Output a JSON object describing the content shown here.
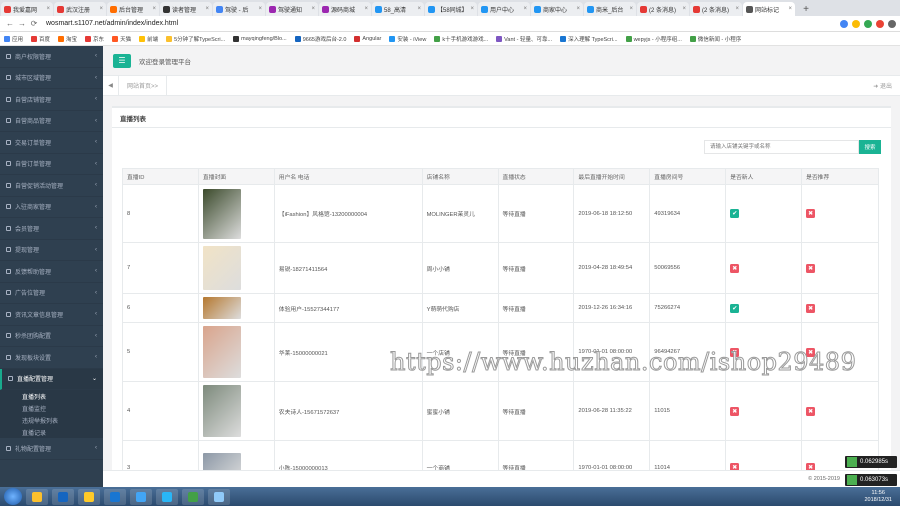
{
  "browser": {
    "tabs": [
      {
        "label": "我爱嘉网",
        "color": "#e53935"
      },
      {
        "label": "武汉注册",
        "color": "#e53935"
      },
      {
        "label": "后台管理",
        "color": "#ff6d00"
      },
      {
        "label": "读者管理",
        "color": "#333333"
      },
      {
        "label": "驾驶 - 后",
        "color": "#4285f4"
      },
      {
        "label": "驾驶通知",
        "color": "#9c27b0"
      },
      {
        "label": "源码商城",
        "color": "#9c27b0"
      },
      {
        "label": "58_高清",
        "color": "#2196f3"
      },
      {
        "label": "【58同城】",
        "color": "#2196f3"
      },
      {
        "label": "用户中心",
        "color": "#2196f3"
      },
      {
        "label": "商家中心",
        "color": "#2196f3"
      },
      {
        "label": "商米_后台",
        "color": "#2196f3"
      },
      {
        "label": "(2 条消息)",
        "color": "#e53935"
      },
      {
        "label": "(2 条消息)",
        "color": "#e53935"
      },
      {
        "label": "网站标记",
        "color": "#555555",
        "active": true
      }
    ],
    "url": "wosmart.s1107.net/admin/index/index.html",
    "bookmarks": [
      "应用",
      "百度",
      "淘宝",
      "京东",
      "天猫",
      "前端",
      "5分钟了解TypeScri...",
      "mayqingfeng/Blo...",
      "9665游戏后台-2.0",
      "Angular",
      "安装 - iView",
      "k十手机游戏游戏...",
      "Vant - 轻量、可靠...",
      "深入理解 TypeScri...",
      "wepyjs - 小程序组...",
      "微信新闻 - 小程序"
    ]
  },
  "sidebar": {
    "items": [
      {
        "label": "商户权限管理",
        "active": false
      },
      {
        "label": "城市区域管理",
        "active": false
      },
      {
        "label": "自营店铺管理",
        "active": false
      },
      {
        "label": "自营商品管理",
        "active": false
      },
      {
        "label": "交易订单管理",
        "active": false
      },
      {
        "label": "自营订单管理",
        "active": false
      },
      {
        "label": "自营促销活动管理",
        "active": false
      },
      {
        "label": "入驻商家管理",
        "active": false
      },
      {
        "label": "会员管理",
        "active": false
      },
      {
        "label": "提现管理",
        "active": false
      },
      {
        "label": "反馈帮助管理",
        "active": false
      },
      {
        "label": "广告位管理",
        "active": false
      },
      {
        "label": "资讯文章信息管理",
        "active": false
      },
      {
        "label": "秒杀团购配置",
        "active": false
      },
      {
        "label": "发现板块设置",
        "active": false
      },
      {
        "label": "直播配置管理",
        "active": true
      }
    ],
    "subitems": [
      {
        "label": "直播列表",
        "active": true
      },
      {
        "label": "直播监控",
        "active": false
      },
      {
        "label": "违规举报列表",
        "active": false
      },
      {
        "label": "直播记录",
        "active": false
      }
    ],
    "last_item": "礼物配置管理"
  },
  "header": {
    "menu_icon": "☰",
    "welcome": "欢迎登录管理平台"
  },
  "crumbs": {
    "back": "◀",
    "tab": "网站首页>>",
    "logout": "➜ 退出"
  },
  "panel": {
    "title": "直播列表",
    "search_placeholder": "请输入店铺关键字或名称",
    "search_button": "搜索"
  },
  "table": {
    "headers": [
      "直播ID",
      "直播封面",
      "用户名 电话",
      "店铺名称",
      "直播状态",
      "最后直播开始时间",
      "直播房间号",
      "是否新人",
      "是否推荐"
    ],
    "rows": [
      {
        "id": "8",
        "cover_color": "#3b4a2b",
        "cover_h": 50,
        "user": "【iFashion】风格馆-13200000004",
        "shop": "MOLINGER茉灵儿",
        "status": "等待直播",
        "time": "2019-06-18 18:12:50",
        "room": "49319634",
        "is_new": true,
        "recommend": false
      },
      {
        "id": "7",
        "cover_color": "#f1e3c6",
        "cover_h": 44,
        "user": "易锐-18271411564",
        "shop": "周小小铺",
        "status": "等待直播",
        "time": "2019-04-28 18:49:54",
        "room": "50069556",
        "is_new": false,
        "recommend": false
      },
      {
        "id": "6",
        "cover_color": "#b5782f",
        "cover_h": 22,
        "user": "体验用户-15527344177",
        "shop": "Y萌萌代购店",
        "status": "等待直播",
        "time": "2019-12-26 16:34:16",
        "room": "75266274",
        "is_new": true,
        "recommend": false
      },
      {
        "id": "5",
        "cover_color": "#d9a48c",
        "cover_h": 52,
        "user": "华莱-15000000021",
        "shop": "一个店铺",
        "status": "等待直播",
        "time": "1970-01-01 08:00:00",
        "room": "96494267",
        "is_new": false,
        "recommend": false
      },
      {
        "id": "4",
        "cover_color": "#7d8a7c",
        "cover_h": 52,
        "user": "农夫诗人-15671572637",
        "shop": "蜜蜜小铺",
        "status": "等待直播",
        "time": "2019-06-28 11:35:22",
        "room": "11015",
        "is_new": false,
        "recommend": false
      },
      {
        "id": "3",
        "cover_color": "#8c98a6",
        "cover_h": 30,
        "user": "小陈-15000000013",
        "shop": "一个商铺",
        "status": "等待直播",
        "time": "1970-01-01 08:00:00",
        "room": "11014",
        "is_new": false,
        "recommend": false
      }
    ]
  },
  "footer": "© 2015-2019",
  "watermark": "https://www.huzhan.com/ishop29489",
  "floating": [
    "0.062985s",
    "0.063073s"
  ],
  "taskbar": {
    "apps": [
      {
        "name": "chrome",
        "color": "#fbc02d"
      },
      {
        "name": "app",
        "color": "#1565c0"
      },
      {
        "name": "folder",
        "color": "#ffca28"
      },
      {
        "name": "word",
        "color": "#1976d2"
      },
      {
        "name": "ie",
        "color": "#42a5f5"
      },
      {
        "name": "qq",
        "color": "#29b6f6"
      },
      {
        "name": "wechat",
        "color": "#43a047"
      },
      {
        "name": "notepad",
        "color": "#90caf9"
      }
    ],
    "time": "11:56",
    "date": "2018/12/31"
  },
  "colors": {
    "accent": "#1ab394",
    "danger": "#ed5565",
    "sidebar": "#2f4050"
  }
}
